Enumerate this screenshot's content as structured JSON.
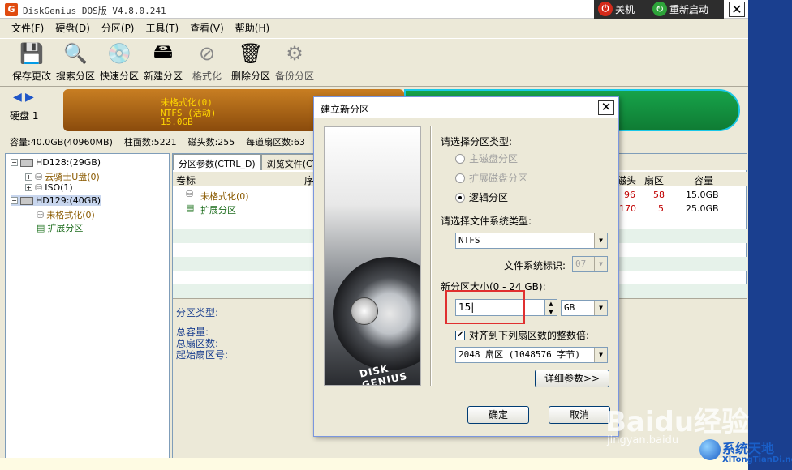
{
  "window": {
    "title": "DiskGenius DOS版 V4.8.0.241",
    "app_icon": "G",
    "shutdown_label": "关机",
    "restart_label": "重新启动",
    "close_glyph": "✕"
  },
  "menu": [
    "文件(F)",
    "硬盘(D)",
    "分区(P)",
    "工具(T)",
    "查看(V)",
    "帮助(H)"
  ],
  "toolbar": [
    {
      "label": "保存更改",
      "icon": "save-icon",
      "glyph": "💾"
    },
    {
      "label": "搜索分区",
      "icon": "magnifier-icon",
      "glyph": "🔍"
    },
    {
      "label": "快速分区",
      "icon": "quick-partition-icon",
      "glyph": "💿"
    },
    {
      "label": "新建分区",
      "icon": "new-partition-icon",
      "glyph": "🖴"
    },
    {
      "label": "格式化",
      "icon": "format-icon",
      "glyph": "⊘"
    },
    {
      "label": "删除分区",
      "icon": "trash-icon",
      "glyph": "🗑"
    },
    {
      "label": "备份分区",
      "icon": "backup-icon",
      "glyph": "⚙"
    }
  ],
  "diskmap": {
    "disk_label": "硬盘 1",
    "part1_lines": [
      "未格式化(0)",
      "NTFS (活动)",
      "15.0GB"
    ]
  },
  "info": {
    "capacity": "容量:40.0GB(40960MB)",
    "cylinders": "柱面数:5221",
    "heads": "磁头数:255",
    "sectors": "每道扇区数:63"
  },
  "tree": [
    {
      "label": "HD128:(29GB)",
      "type": "disk"
    },
    {
      "label": "云骑士U盘(0)",
      "type": "part"
    },
    {
      "label": "ISO(1)",
      "type": "part"
    },
    {
      "label": "HD129:(40GB)",
      "type": "disk"
    },
    {
      "label": "未格式化(0)",
      "type": "part"
    },
    {
      "label": "扩展分区",
      "type": "part"
    }
  ],
  "right": {
    "tabs": [
      "分区参数(CTRL_D)",
      "浏览文件(CT"
    ],
    "headers": {
      "label": "卷标",
      "seq": "序",
      "head": "磁头",
      "sector": "扇区",
      "capacity": "容量"
    },
    "rows": [
      {
        "label": "未格式化(0)",
        "head": "96",
        "sector": "58",
        "capacity": "15.0GB"
      },
      {
        "label": "扩展分区",
        "head": "170",
        "sector": "5",
        "capacity": "25.0GB"
      }
    ],
    "detail": {
      "type_label": "分区类型:",
      "total_capacity": "总容量:",
      "total_sectors": "总扇区数:",
      "start_sector": "起始扇区号:"
    }
  },
  "dialog": {
    "title": "建立新分区",
    "close_glyph": "✕",
    "brand": "DISK GENIUS",
    "type_prompt": "请选择分区类型:",
    "types": [
      {
        "label": "主磁盘分区",
        "checked": false,
        "disabled": true
      },
      {
        "label": "扩展磁盘分区",
        "checked": false,
        "disabled": true
      },
      {
        "label": "逻辑分区",
        "checked": true,
        "disabled": false
      }
    ],
    "fs_prompt": "请选择文件系统类型:",
    "fs_value": "NTFS",
    "fs_id_label": "文件系统标识:",
    "fs_id_value": "07",
    "size_label": "新分区大小(0 - 24 GB):",
    "size_value": "15",
    "unit_value": "GB",
    "align_label": "对齐到下列扇区数的整数倍:",
    "align_value": "2048 扇区 (1048576 字节)",
    "advanced_button": "详细参数>>",
    "ok_button": "确定",
    "cancel_button": "取消"
  },
  "watermark": {
    "baidu": "Baidu经验",
    "jingyan": "jingyan.baidu",
    "site_title": "系统天地",
    "site_url": "XiTongTianDi.net"
  }
}
